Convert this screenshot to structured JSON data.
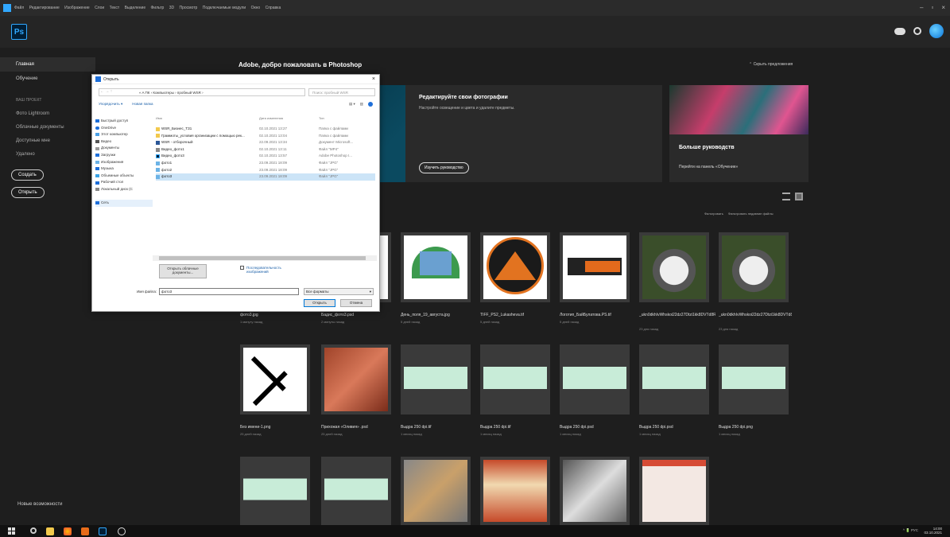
{
  "titlebar": {
    "menu": [
      "Файл",
      "Редактирование",
      "Изображение",
      "Слои",
      "Текст",
      "Выделение",
      "Фильтр",
      "3D",
      "Просмотр",
      "Подключаемые модули",
      "Окно",
      "Справка"
    ],
    "controls": [
      "–",
      "▫",
      "×"
    ]
  },
  "app": {
    "logo": "Ps"
  },
  "sidebar": {
    "items": [
      {
        "label": "Главная"
      },
      {
        "label": "Обучение"
      }
    ],
    "section": "ВАШ ПРОЕКТ",
    "subitems": [
      {
        "label": "Фото Lightroom"
      },
      {
        "label": "Облачные документы"
      },
      {
        "label": "Доступные мне"
      },
      {
        "label": "Удалено"
      }
    ],
    "create": "Создать",
    "open": "Открыть",
    "whats_new": "Новые возможности"
  },
  "main": {
    "welcome": "Adobe, добро пожаловать в Photoshop",
    "hide_suggestions": "Скрыть предложения",
    "hero": {
      "title": "Редактируйте свои фотографии",
      "subtitle": "Настройте освещение и цвета и удалите предметы.",
      "button": "Изучить руководство"
    },
    "guides": {
      "title": "Больше руководств",
      "link": "Перейти на панель «Обучение»"
    },
    "filter_label": "Фильтровать",
    "filter_placeholder": "Фильтровать недавние файлы",
    "files": [
      {
        "name": "фото3.jpg",
        "meta": "1 минуту назад"
      },
      {
        "name": "Бадис_фото3.psd",
        "meta": "2 минуты назад"
      },
      {
        "name": "День_поля_19_августа.jpg",
        "meta": "5 дней назад"
      },
      {
        "name": "TIFF_PS2_Lukasheva.tif",
        "meta": "5 дней назад"
      },
      {
        "name": "Логотип_БайБулатова.PS.tif",
        "meta": "5 дней назад"
      },
      {
        "name": "_ukn0dkhIvWhskoi22dz27Dtzi1kk8DVTd8R_VCxCUnPN_3BVTen...",
        "meta": "23 дня назад"
      },
      {
        "name": "_ukn0dkhIvWhskoi22dz27Dtzi1kk8DVTd8R_VCxCUnPN_3BVTen...",
        "meta": "23 дня назад"
      },
      {
        "name": "Без имени-1.png",
        "meta": "25 дней назад"
      },
      {
        "name": "Прихожая «Оливия» .psd",
        "meta": "25 дней назад"
      },
      {
        "name": "Выдра 250 dpi.tif",
        "meta": "1 месяц назад"
      },
      {
        "name": "Выдра 250 dpi.tif",
        "meta": "1 месяц назад"
      },
      {
        "name": "Выдра 250 dpi.psd",
        "meta": "1 месяц назад"
      },
      {
        "name": "Выдра 250 dpi.psd",
        "meta": "1 месяц назад"
      },
      {
        "name": "Выдра 250 dpi.png",
        "meta": "1 месяц назад"
      }
    ]
  },
  "dialog": {
    "title": "Открыть",
    "address": "« A ПК › Компьютеры › пробный WSR ›",
    "search_placeholder": "Поиск: пробный WSR",
    "toolbar": {
      "organize": "Упорядочить ▾",
      "new_folder": "Новая папка"
    },
    "nav": [
      "Быстрый доступ",
      "OneDrive",
      "Этот компьютер",
      "Видео",
      "Документы",
      "Загрузки",
      "Изображения",
      "Музыка",
      "Объемные объекты",
      "Рабочий стол",
      "Локальный диск (C",
      "",
      "Сеть"
    ],
    "columns": [
      "Имя",
      "Дата изменения",
      "Тип"
    ],
    "files": [
      {
        "name": "WSR_Бизнес_ТЗ1",
        "date": "02.10.2021 13:27",
        "type": "Папка с файлами"
      },
      {
        "name": "Граммоты_условия организации с помощью рек...",
        "date": "02.10.2021 13:04",
        "type": "Папка с файлами"
      },
      {
        "name": "WSR - отборочный",
        "date": "22.09.2021 13:34",
        "type": "Документ Microsoft..."
      },
      {
        "name": "Видео_фото1",
        "date": "02.10.2021 13:11",
        "type": "Файл \"MP4\""
      },
      {
        "name": "Видео_фото3",
        "date": "02.10.2021 13:57",
        "type": "Adobe Photoshop I..."
      },
      {
        "name": "фото1",
        "date": "23.09.2021 18:09",
        "type": "Файл \"JPG\""
      },
      {
        "name": "фото2",
        "date": "23.09.2021 18:09",
        "type": "Файл \"JPG\""
      },
      {
        "name": "фото3",
        "date": "23.09.2021 18:09",
        "type": "Файл \"JPG\""
      }
    ],
    "open_as": "Открыть облачные документы...",
    "sequence": "Последовательность изображений",
    "filename_label": "Имя файла:",
    "filename_value": "фото3",
    "filetype": "Все форматы",
    "open_btn": "Открыть",
    "cancel_btn": "Отмена"
  },
  "taskbar": {
    "tray": "^ 🔋 РУС",
    "time": "14:00",
    "date": "03.10.2021"
  }
}
